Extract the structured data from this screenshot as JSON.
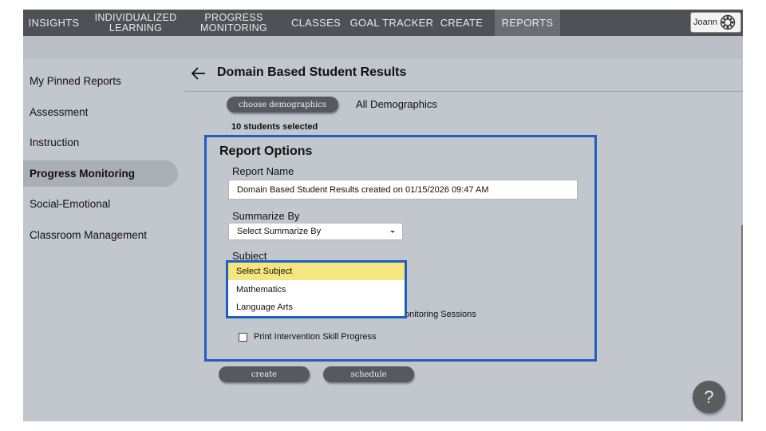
{
  "nav": {
    "items": [
      {
        "line1": "INSIGHTS",
        "line2": ""
      },
      {
        "line1": "INDIVIDUALIZED",
        "line2": "LEARNING"
      },
      {
        "line1": "PROGRESS",
        "line2": "MONITORING"
      },
      {
        "line1": "CLASSES",
        "line2": ""
      },
      {
        "line1": "GOAL TRACKER",
        "line2": ""
      },
      {
        "line1": "CREATE",
        "line2": ""
      },
      {
        "line1": "REPORTS",
        "line2": ""
      }
    ],
    "active": "REPORTS",
    "user_name": "Joann"
  },
  "sidebar": {
    "items": [
      {
        "label": "My Pinned Reports"
      },
      {
        "label": "Assessment"
      },
      {
        "label": "Instruction"
      },
      {
        "label": "Progress Monitoring"
      },
      {
        "label": "Social-Emotional"
      },
      {
        "label": "Classroom Management"
      }
    ],
    "active": "Progress Monitoring"
  },
  "main": {
    "title": "Domain Based Student Results",
    "choose_demographics_label": "choose demographics",
    "demographics_value": "All Demographics",
    "students_selected": "10 students selected",
    "report_options": {
      "heading": "Report Options",
      "report_name_label": "Report Name",
      "report_name_value": "Domain Based Student Results created on 01/15/2026 09:47 AM",
      "summarize_by_label": "Summarize By",
      "summarize_by_value": "Select Summarize By",
      "subject_label": "Subject",
      "subject_options": [
        "Select Subject",
        "Mathematics",
        "Language Arts"
      ],
      "subject_selected": "Select Subject",
      "hidden_option_fragment": "onitoring Sessions",
      "print_progress_label": "Print Intervention Skill Progress",
      "print_progress_checked": false
    },
    "create_label": "create",
    "schedule_label": "schedule",
    "help_label": "?"
  },
  "colors": {
    "nav_bg": "#4e5155",
    "page_bg": "#c2c6cd",
    "accent_outline": "#1f5fbf",
    "selected_option": "#f5e680",
    "pill_bg": "#56595e"
  }
}
